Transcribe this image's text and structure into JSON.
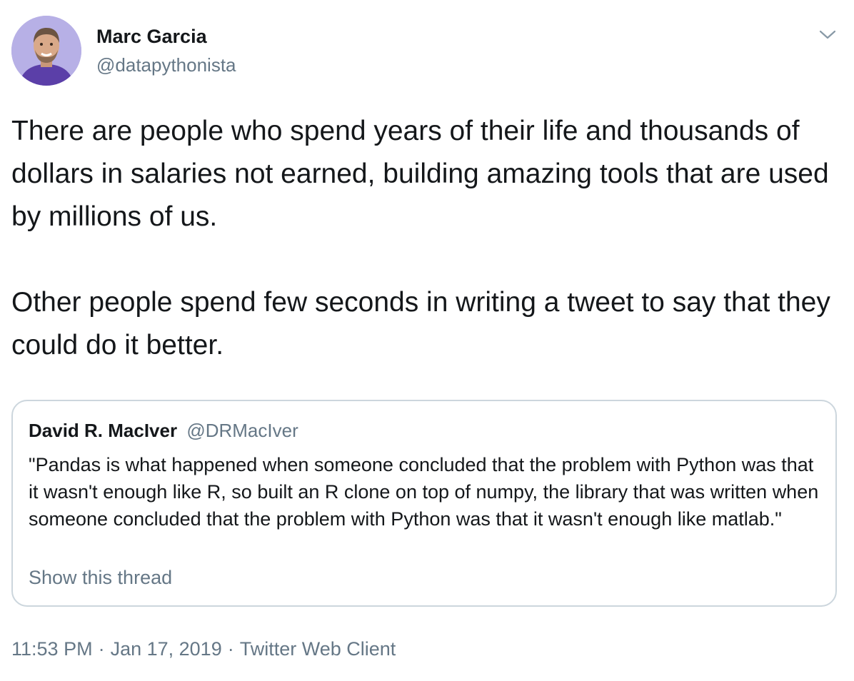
{
  "author": {
    "name": "Marc Garcia",
    "handle": "@datapythonista"
  },
  "menu_icon": "chevron-down-icon",
  "tweet": {
    "paragraphs": [
      "There are people who spend years of their life and thousands of dollars in salaries not earned, building amazing tools that are used by millions of us.",
      "Other people spend few seconds in writing a tweet to say that they could do it better."
    ]
  },
  "quoted_tweet": {
    "author_name": "David R. MacIver",
    "author_handle": "@DRMacIver",
    "text": "\"Pandas is what happened when someone concluded that the problem with Python was that it wasn't enough like R, so built an R clone on top of numpy, the library that was written when someone concluded that the problem with Python was that it wasn't enough like matlab.\"",
    "show_thread_label": "Show this thread"
  },
  "meta": {
    "time": "11:53 PM",
    "separator": "·",
    "date": "Jan 17, 2019",
    "client": "Twitter Web Client"
  },
  "colors": {
    "text_primary": "#14171a",
    "text_secondary": "#657786",
    "border": "#ccd6dd",
    "avatar_bg": "#b7b0e6",
    "shirt": "#5b3fa8"
  }
}
